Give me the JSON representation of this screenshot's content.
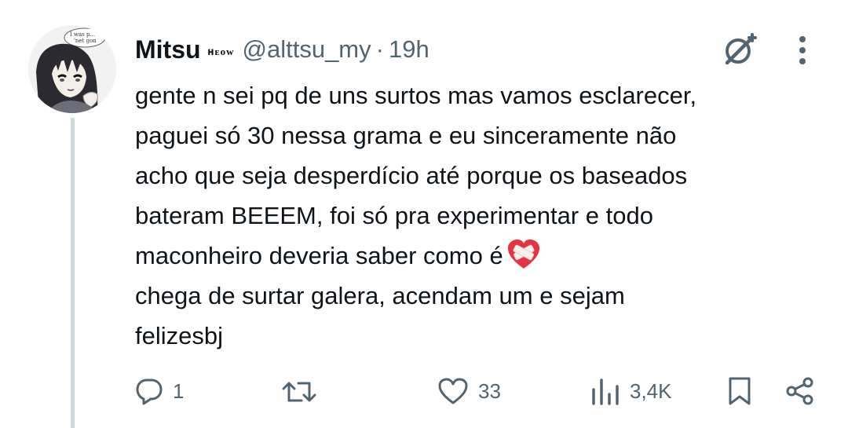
{
  "author": {
    "display_name": "Mitsu",
    "name_badge": "ʜᴇᴏᴡ",
    "handle": "@alttsu_my",
    "separator": "·",
    "time": "19h",
    "avatar_icon": "anime-girl-avatar",
    "avatar_caption_1": "I was p...",
    "avatar_caption_2": "'net gon"
  },
  "tweet": {
    "lines": [
      "gente n sei pq de uns surtos mas vamos esclarecer,",
      "paguei só 30 nessa grama e eu sinceramente não",
      "acho que seja desperdício até porque os baseados",
      "bateram BEEEM, foi só pra experimentar e todo",
      "maconheiro deveria saber como é",
      "chega de surtar galera, acendam um e sejam",
      "felizesbj"
    ],
    "emoji": "mending-heart"
  },
  "header_icons": {
    "grok": "grok-icon",
    "more": "more-options-icon"
  },
  "actions": {
    "reply_count": "1",
    "retweet_count": "",
    "like_count": "33",
    "views_count": "3,4K",
    "icons": {
      "reply": "reply-icon",
      "retweet": "retweet-icon",
      "like": "like-heart-icon",
      "views": "views-chart-icon",
      "bookmark": "bookmark-icon",
      "share": "share-icon"
    }
  },
  "colors": {
    "text": "#0f1419",
    "secondary": "#536471",
    "thread_line": "#cfd9de",
    "emoji_red": "#e8323f"
  }
}
